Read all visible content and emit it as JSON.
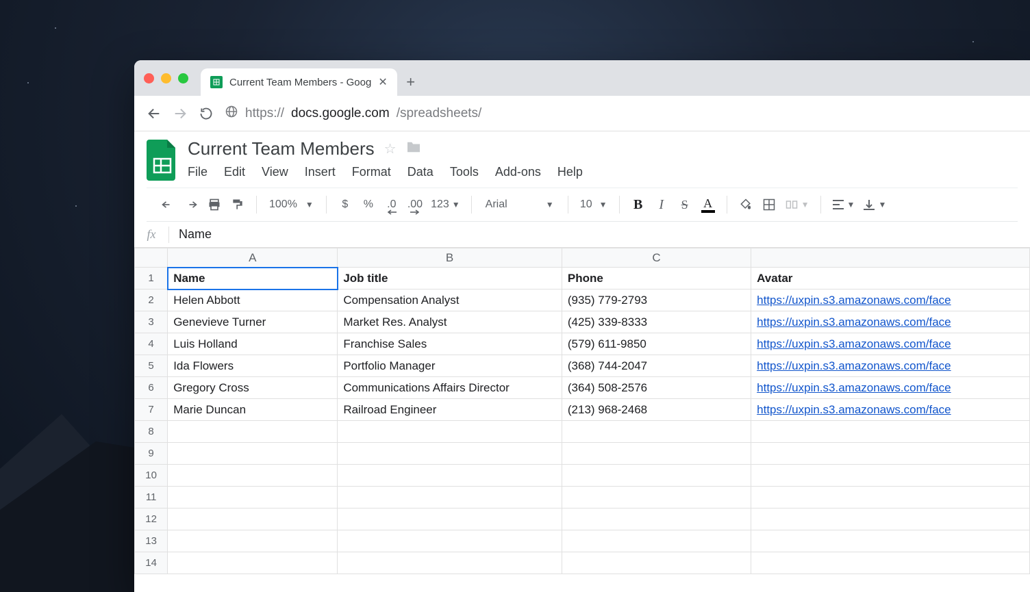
{
  "browser": {
    "tab_title": "Current Team Members - Goog",
    "url_protocol": "https://",
    "url_host": "docs.google.com",
    "url_path": "/spreadsheets/"
  },
  "doc": {
    "title": "Current Team Members",
    "menus": [
      "File",
      "Edit",
      "View",
      "Insert",
      "Format",
      "Data",
      "Tools",
      "Add-ons",
      "Help"
    ]
  },
  "toolbar": {
    "zoom": "100%",
    "currency": "$",
    "percent": "%",
    "dec_dec": ".0",
    "inc_dec": ".00",
    "numfmt": "123",
    "font": "Arial",
    "fontsize": "10"
  },
  "formula_bar": {
    "label": "fx",
    "value": "Name"
  },
  "columns": [
    "A",
    "B",
    "C",
    ""
  ],
  "headers": [
    "Name",
    "Job title",
    "Phone",
    "Avatar"
  ],
  "rows": [
    {
      "name": "Helen Abbott",
      "job": "Compensation Analyst",
      "phone": "(935) 779-2793",
      "avatar": "https://uxpin.s3.amazonaws.com/face"
    },
    {
      "name": "Genevieve Turner",
      "job": "Market Res. Analyst",
      "phone": "(425) 339-8333",
      "avatar": "https://uxpin.s3.amazonaws.com/face"
    },
    {
      "name": "Luis Holland",
      "job": "Franchise Sales",
      "phone": "(579) 611-9850",
      "avatar": "https://uxpin.s3.amazonaws.com/face"
    },
    {
      "name": "Ida Flowers",
      "job": "Portfolio Manager",
      "phone": "(368) 744-2047",
      "avatar": "https://uxpin.s3.amazonaws.com/face"
    },
    {
      "name": "Gregory Cross",
      "job": "Communications Affairs Director",
      "phone": "(364) 508-2576",
      "avatar": "https://uxpin.s3.amazonaws.com/face"
    },
    {
      "name": "Marie Duncan",
      "job": "Railroad Engineer",
      "phone": "(213) 968-2468",
      "avatar": "https://uxpin.s3.amazonaws.com/face"
    }
  ],
  "empty_rows": 7,
  "selected_cell": "A1"
}
